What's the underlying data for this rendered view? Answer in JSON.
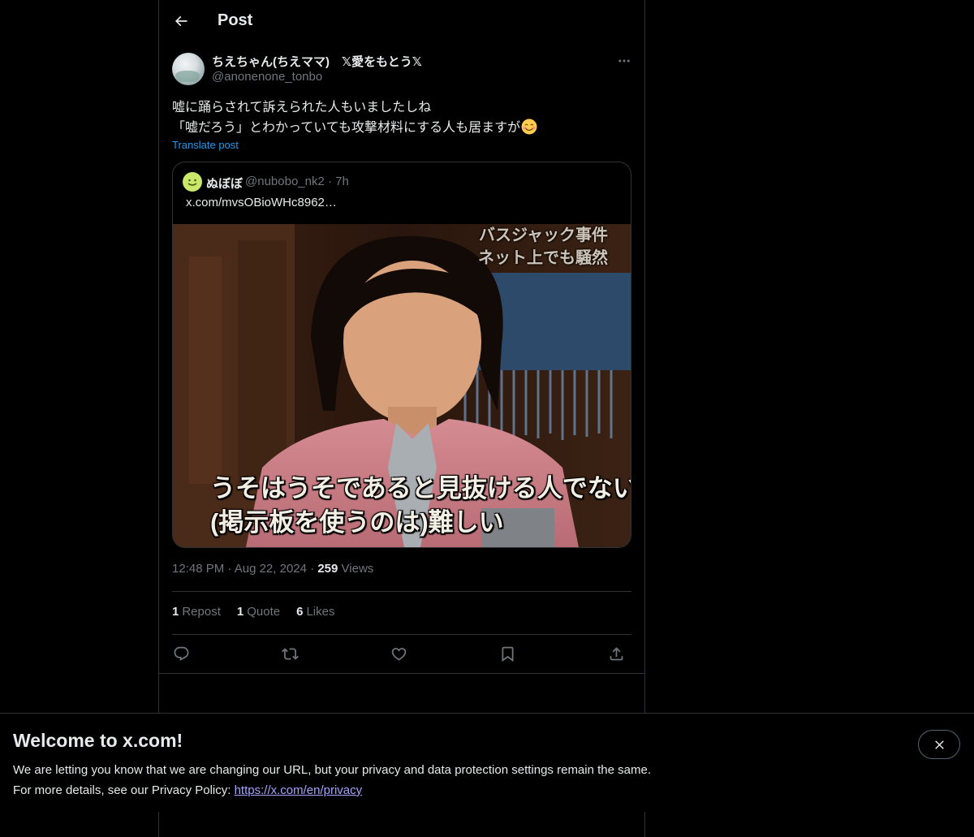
{
  "header": {
    "title": "Post",
    "back_icon": "arrow-left-icon"
  },
  "post": {
    "author_name": "ちえちゃん(ちえママ)　𝕏愛をもとう𝕏",
    "author_handle": "@anonenone_tonbo",
    "text_line1": "嘘に踊らされて訴えられた人もいましたしね",
    "text_line2": "「嘘だろう」とわかっていても攻撃材料にする人も居ますが",
    "emoji": "smiling-face-emoji",
    "translate_label": "Translate post",
    "time": "12:48 PM",
    "date": "Aug 22, 2024",
    "views_count": "259",
    "views_label": "Views",
    "separator": "·"
  },
  "quote": {
    "name": "ぬぼぼ",
    "handle": "@nubobo_nk2",
    "age": "7h",
    "text": "x.com/mvsOBioWHc8962…",
    "media": {
      "caption_top_line1": "バスジャック事件",
      "caption_top_line2": "ネット上でも騒然",
      "caption_bottom_line1": "うそはうそであると見抜ける人でないと",
      "caption_bottom_line2": "(掲示板を使うのは)難しい"
    }
  },
  "stats": {
    "reposts_count": "1",
    "reposts_label": "Repost",
    "quotes_count": "1",
    "quotes_label": "Quote",
    "likes_count": "6",
    "likes_label": "Likes"
  },
  "actions": [
    "reply-icon",
    "repost-icon",
    "like-icon",
    "bookmark-icon",
    "share-icon"
  ],
  "banner": {
    "title": "Welcome to x.com!",
    "line1": "We are letting you know that we are changing our URL, but your privacy and data protection settings remain the same.",
    "line2_prefix": "For more details, see our Privacy Policy: ",
    "link": "https://x.com/en/privacy",
    "close_icon": "close-icon"
  },
  "colors": {
    "background": "#000000",
    "text": "#e7e9ea",
    "muted": "#71767b",
    "accent": "#1d9bf0",
    "border": "#2f3336"
  }
}
